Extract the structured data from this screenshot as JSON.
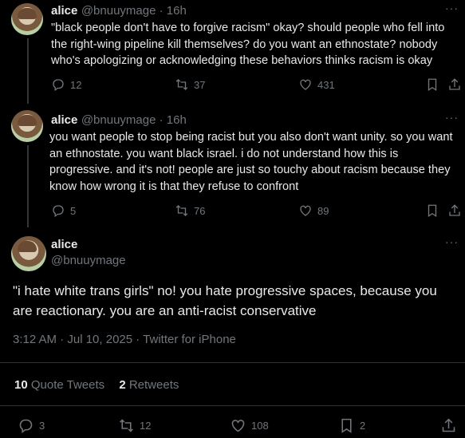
{
  "tweets": [
    {
      "name": "alice",
      "handle": "@bnuuymage",
      "time": "16h",
      "text": "\"black people don't have to forgive racism\" okay? should people who fell into the right-wing pipeline kill themselves? do you want an ethnostate? nobody who's apologizing or acknowledging these behaviors thinks racism is okay",
      "replies": "12",
      "retweets": "37",
      "likes": "431"
    },
    {
      "name": "alice",
      "handle": "@bnuuymage",
      "time": "16h",
      "text": "you want people to stop being racist but you also don't want unity. so you want an ethnostate. you want black israel. i do not understand how this is progressive. and it's not! people are just so touchy about racism  because they know how wrong it is that they refuse to confront",
      "replies": "5",
      "retweets": "76",
      "likes": "89"
    }
  ],
  "main_tweet": {
    "name": "alice",
    "handle": "@bnuuymage",
    "text": "\"i hate white trans girls\" no! you hate progressive spaces, because you are reactionary. you are an anti-racist conservative",
    "timestamp": "3:12 AM · Jul 10, 2025 · Twitter for iPhone",
    "quote_tweets_count": "10",
    "quote_tweets_label": "Quote Tweets",
    "retweets_count": "2",
    "retweets_label": "Retweets",
    "replies": "3",
    "retweets": "12",
    "likes": "108",
    "bookmarks": "2"
  },
  "icons": {
    "reply": "reply-icon",
    "retweet": "retweet-icon",
    "like": "heart-icon",
    "bookmark": "bookmark-icon",
    "share": "share-icon",
    "more": "more-icon"
  },
  "colors": {
    "background": "#000000",
    "text": "#e7e9ea",
    "muted": "#71767b",
    "divider": "#2f3336"
  }
}
